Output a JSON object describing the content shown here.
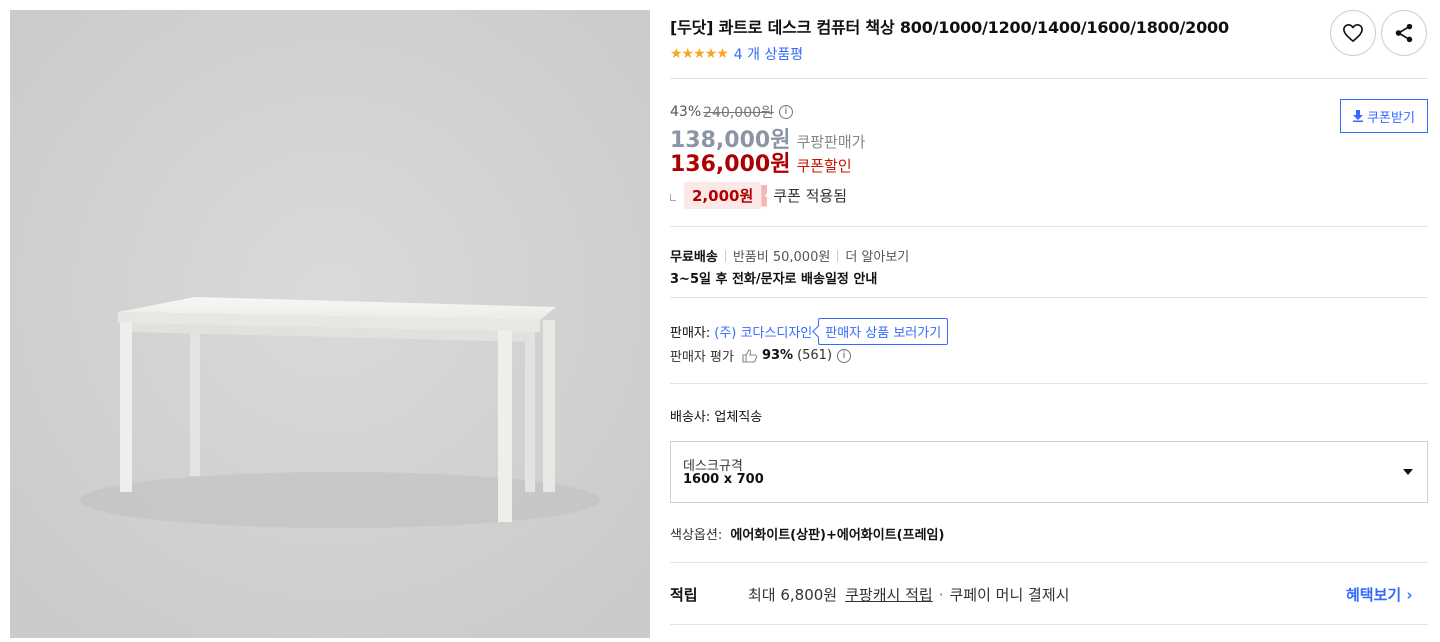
{
  "product": {
    "title": "[두닷] 콰트로 데스크 컴퓨터 책상 800/1000/1200/1400/1600/1800/2000",
    "stars": "★★★★★",
    "review_link": "4 개 상품평"
  },
  "price": {
    "discount_rate": "43%",
    "original_price": "240,000원",
    "info_icon": "ⓘ",
    "sale_price": "138,000원",
    "sale_label": "쿠팡판매가",
    "coupon_price": "136,000원",
    "coupon_label": "쿠폰할인",
    "coupon_amount": "2,000원",
    "coupon_applied": "쿠폰 적용됨",
    "coupon_button": "쿠폰받기"
  },
  "shipping": {
    "free": "무료배송",
    "return_fee": "반품비 50,000원",
    "more": "더 알아보기",
    "schedule": "3~5일 후 전화/문자로 배송일정 안내"
  },
  "seller": {
    "label": "판매자:",
    "name": "(주) 코다스디자인",
    "button": "판매자 상품 보러가기",
    "rating_label": "판매자 평가",
    "rating_pct": "93%",
    "rating_count": "(561)"
  },
  "carrier": {
    "text": "배송사:  업체직송"
  },
  "option": {
    "label": "데스크규격",
    "value": "1600 x 700"
  },
  "color_option": {
    "label": "색상옵션:",
    "value": "에어화이트(상판)+에어화이트(프레임)"
  },
  "reward": {
    "label": "적립",
    "max": "최대 6,800원",
    "cash_link": "쿠팡캐시 적립",
    "payment": "쿠페이 머니 결제시",
    "benefit_link": "혜택보기 ›"
  },
  "colors": {
    "accent": "#346aff",
    "price_red": "#ae0000",
    "star": "#f5a623",
    "image_bg": "#d2d2d2"
  }
}
